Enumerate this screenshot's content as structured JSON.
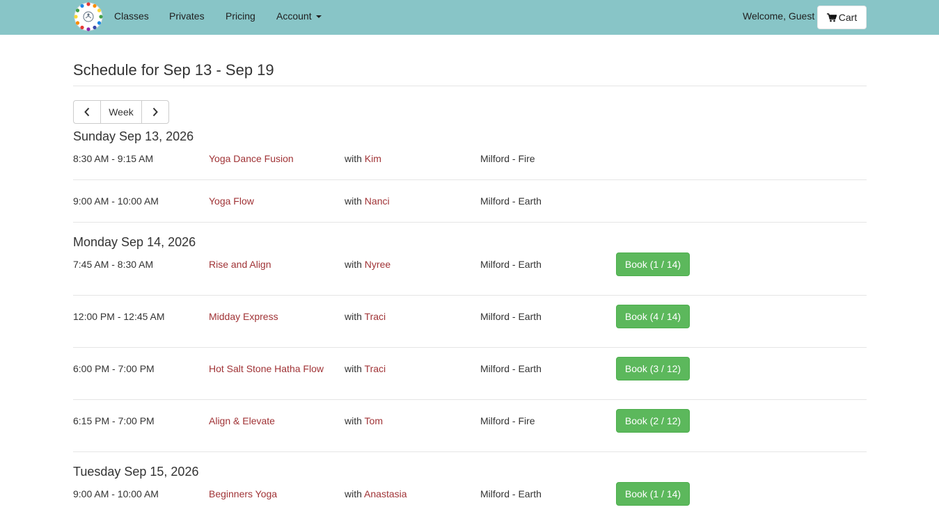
{
  "nav": {
    "logo_icon": "yoga-circle-logo",
    "links": [
      "Classes",
      "Privates",
      "Pricing"
    ],
    "account_label": "Account",
    "welcome": "Welcome, Guest",
    "cart_label": "Cart",
    "cart_icon": "shopping-cart-icon",
    "bg_color": "#88c5c7"
  },
  "schedule": {
    "title": "Schedule for Sep 13 - Sep 19",
    "week_label": "Week",
    "days": [
      {
        "heading": "Sunday  Sep 13, 2026",
        "classes": [
          {
            "time": "8:30 AM - 9:15 AM",
            "name": "Yoga Dance Fusion",
            "with": "with",
            "instructor": "Kim",
            "location": "Milford - Fire",
            "book": ""
          },
          {
            "time": "9:00 AM - 10:00 AM",
            "name": "Yoga Flow",
            "with": "with",
            "instructor": "Nanci",
            "location": "Milford - Earth",
            "book": ""
          }
        ]
      },
      {
        "heading": "Monday  Sep 14, 2026",
        "classes": [
          {
            "time": "7:45 AM - 8:30 AM",
            "name": "Rise and Align",
            "with": "with",
            "instructor": "Nyree",
            "location": "Milford - Earth",
            "book": "Book (1 / 14)"
          },
          {
            "time": "12:00 PM - 12:45 AM",
            "name": "Midday Express",
            "with": "with",
            "instructor": "Traci",
            "location": "Milford - Earth",
            "book": "Book (4 / 14)"
          },
          {
            "time": "6:00 PM - 7:00 PM",
            "name": "Hot Salt Stone Hatha Flow",
            "with": "with",
            "instructor": "Traci",
            "location": "Milford - Earth",
            "book": "Book (3 / 12)"
          },
          {
            "time": "6:15 PM - 7:00 PM",
            "name": "Align & Elevate",
            "with": "with",
            "instructor": "Tom",
            "location": "Milford - Fire",
            "book": "Book (2 / 12)"
          }
        ]
      },
      {
        "heading": "Tuesday  Sep 15, 2026",
        "classes": [
          {
            "time": "9:00 AM - 10:00 AM",
            "name": "Beginners Yoga",
            "with": "with",
            "instructor": "Anastasia",
            "location": "Milford - Earth",
            "book": "Book (1 / 14)"
          }
        ]
      }
    ]
  },
  "colors": {
    "link": "#a03336",
    "book_button": "#5cb85c"
  }
}
